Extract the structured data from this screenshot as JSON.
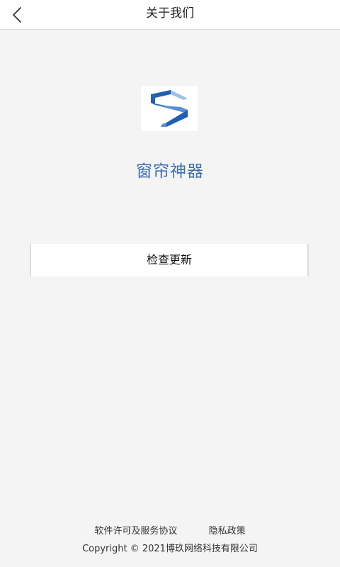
{
  "header": {
    "title": "关于我们",
    "back_icon": "chevron-left-icon"
  },
  "app": {
    "name": "窗帘神器",
    "logo_icon": "app-logo-s-icon",
    "brand_colors": [
      "#1f5fb4",
      "#5a8fd4",
      "#9ec0ea"
    ]
  },
  "actions": {
    "check_update_label": "检查更新"
  },
  "footer": {
    "license_link": "软件许可及服务协议",
    "privacy_link": "隐私政策",
    "copyright": "Copyright © 2021博玖网络科技有限公司"
  },
  "colors": {
    "background": "#f4f4f4",
    "app_name": "#3d6fb0"
  }
}
